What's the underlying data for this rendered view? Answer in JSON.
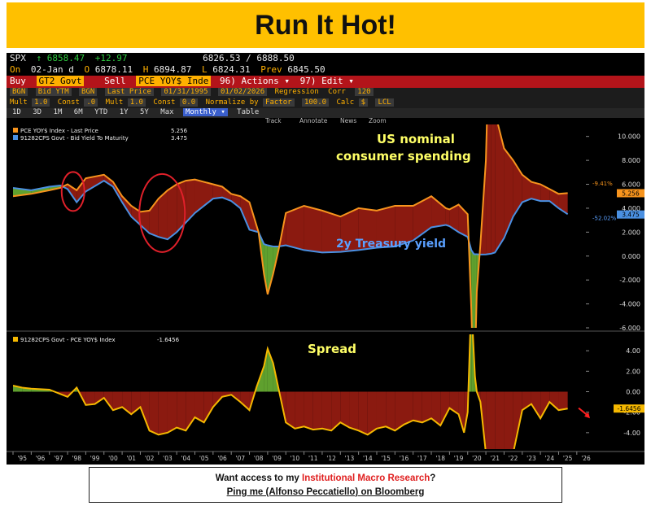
{
  "banner": {
    "title": "Run It Hot!"
  },
  "terminal": {
    "quote_line": {
      "ticker": "SPX",
      "arrow": "↑",
      "last": "6858.47",
      "change": "+12.97",
      "bid_ask": "6826.53 / 6888.50"
    },
    "ohlc_line": {
      "on": "On",
      "date": "02-Jan d",
      "open_label": "O",
      "open": "6878.11",
      "high_label": "H",
      "high": "6894.87",
      "low_label": "L",
      "low": "6824.31",
      "prev_label": "Prev",
      "prev": "6845.50"
    },
    "command_bar": {
      "buy": "Buy",
      "buy_field": "GT2 Govt",
      "sell": "Sell",
      "sell_field": "PCE YOY$ Inde",
      "actions": "96) Actions ▾",
      "edit": "97) Edit ▾"
    },
    "settings1": {
      "src1": "BGN",
      "field1": "Bid YTM",
      "src2": "BGN",
      "field2": "Last Price",
      "start": "01/31/1995",
      "end": "01/02/2026",
      "regression": "Regression",
      "corr": "Corr",
      "corr_val": "120"
    },
    "settings2": {
      "mult1": "Mult",
      "mult1_val": "1.0",
      "const1": "Const",
      "const1_val": ".0",
      "mult2": "Mult",
      "mult2_val": "1.0",
      "const2": "Const",
      "const2_val": "0.0",
      "normalize": "Normalize by",
      "normalize_val": "Factor",
      "norm_num": "100.0",
      "calc": "Calc",
      "calc_val": "$",
      "lcl": "LCL"
    },
    "period_tabs": [
      "1D",
      "3D",
      "1M",
      "6M",
      "YTD",
      "1Y",
      "5Y",
      "Max",
      "Monthly ▾",
      "Table"
    ],
    "chart_tools": [
      "Track",
      "Annotate",
      "News",
      "Zoom"
    ]
  },
  "chart_data": [
    {
      "type": "area",
      "legend": [
        {
          "name": "PCE YOY$ Index - Last Price",
          "value": "5.256",
          "color": "#f7941d"
        },
        {
          "name": "91282CPS Govt - Bid Yield To Maturity",
          "value": "3.475",
          "color": "#4a90e2"
        }
      ],
      "annotations": [
        "US nominal",
        "consumer spending",
        "2y Treasury yield"
      ],
      "right_labels": {
        "pce_change": "-9.41%",
        "yield_change": "-52.02%",
        "pce_last": "5.256",
        "yield_last": "3.475"
      },
      "ylim": [
        -6,
        11
      ],
      "ytick_labels": [
        "10.000",
        "8.000",
        "6.000",
        "4.000",
        "2.000",
        "0.000",
        "-2.000",
        "-4.000",
        "-6.000"
      ],
      "x": [
        1995.0,
        1996.0,
        1997.0,
        1997.6,
        1998.0,
        1998.5,
        1999.0,
        2000.0,
        2000.5,
        2001.0,
        2001.5,
        2002.0,
        2002.5,
        2003.0,
        2003.5,
        2004.0,
        2004.5,
        2005.0,
        2006.0,
        2006.5,
        2007.0,
        2007.5,
        2008.0,
        2008.5,
        2008.8,
        2009.0,
        2009.3,
        2009.6,
        2010.0,
        2011.0,
        2012.0,
        2013.0,
        2014.0,
        2015.0,
        2016.0,
        2017.0,
        2018.0,
        2018.8,
        2019.0,
        2019.5,
        2020.0,
        2020.2,
        2020.35,
        2020.5,
        2020.7,
        2021.0,
        2021.3,
        2021.5,
        2022.0,
        2022.5,
        2023.0,
        2023.5,
        2024.0,
        2024.5,
        2025.0,
        2025.5
      ],
      "pce": [
        5.0,
        5.2,
        5.5,
        5.7,
        6.0,
        5.5,
        6.5,
        6.8,
        6.2,
        5.0,
        4.2,
        3.7,
        3.8,
        4.8,
        5.5,
        6.0,
        6.3,
        6.4,
        6.0,
        5.8,
        5.2,
        5.0,
        4.5,
        2.0,
        -1.5,
        -3.2,
        -1.5,
        0.5,
        3.6,
        4.2,
        3.8,
        3.3,
        4.0,
        3.8,
        4.2,
        4.2,
        5.0,
        4.0,
        3.9,
        4.3,
        3.5,
        -4.5,
        -12.5,
        -3.0,
        1.0,
        8.0,
        25.0,
        12.0,
        9.0,
        8.0,
        6.8,
        6.2,
        6.0,
        5.6,
        5.2,
        5.26
      ],
      "yield": [
        5.7,
        5.5,
        5.8,
        5.9,
        5.6,
        4.5,
        5.4,
        6.3,
        5.8,
        4.5,
        3.3,
        2.6,
        1.9,
        1.6,
        1.4,
        2.0,
        2.8,
        3.6,
        4.8,
        4.9,
        4.6,
        4.0,
        2.2,
        2.0,
        1.0,
        0.9,
        0.8,
        0.8,
        0.9,
        0.5,
        0.3,
        0.35,
        0.5,
        0.7,
        0.8,
        1.3,
        2.4,
        2.6,
        2.5,
        2.0,
        1.6,
        0.5,
        0.15,
        0.15,
        0.13,
        0.14,
        0.2,
        0.3,
        1.5,
        3.3,
        4.5,
        4.8,
        4.6,
        4.6,
        4.0,
        3.5
      ]
    },
    {
      "type": "area",
      "title": "Spread",
      "legend": [
        {
          "name": "91282CPS Govt - PCE YOY$ Index",
          "value": "-1.6456",
          "color": "#f5b800"
        }
      ],
      "right_labels": {
        "last": "-1.6456"
      },
      "ylim": [
        -5.6,
        5.6
      ],
      "ytick_labels": [
        "4.00",
        "2.00",
        "0.00",
        "-2.00",
        "-4.00"
      ],
      "x": [
        1995.0,
        1995.5,
        1996.0,
        1997.0,
        1998.0,
        1998.5,
        1999.0,
        1999.5,
        2000.0,
        2000.5,
        2001.0,
        2001.5,
        2002.0,
        2002.5,
        2003.0,
        2003.5,
        2004.0,
        2004.5,
        2005.0,
        2005.5,
        2006.0,
        2006.5,
        2007.0,
        2007.5,
        2008.0,
        2008.4,
        2008.8,
        2009.0,
        2009.3,
        2009.6,
        2010.0,
        2010.5,
        2011.0,
        2011.5,
        2012.0,
        2012.5,
        2013.0,
        2013.5,
        2014.0,
        2014.5,
        2015.0,
        2015.5,
        2016.0,
        2016.5,
        2017.0,
        2017.5,
        2018.0,
        2018.5,
        2019.0,
        2019.5,
        2019.8,
        2020.0,
        2020.2,
        2020.3,
        2020.4,
        2020.5,
        2020.7,
        2021.0,
        2021.5,
        2022.0,
        2022.5,
        2023.0,
        2023.5,
        2024.0,
        2024.5,
        2025.0,
        2025.5
      ],
      "values": [
        0.6,
        0.4,
        0.3,
        0.2,
        -0.5,
        0.4,
        -1.3,
        -1.2,
        -0.6,
        -1.8,
        -1.5,
        -2.2,
        -1.5,
        -3.8,
        -4.2,
        -4.0,
        -3.5,
        -3.8,
        -2.5,
        -3.0,
        -1.5,
        -0.5,
        -0.3,
        -1.0,
        -1.8,
        0.5,
        2.5,
        4.2,
        2.8,
        0.3,
        -3.0,
        -3.6,
        -3.4,
        -3.7,
        -3.6,
        -3.8,
        -3.0,
        -3.5,
        -3.8,
        -4.2,
        -3.6,
        -3.4,
        -3.8,
        -3.2,
        -2.8,
        -3.0,
        -2.6,
        -3.3,
        -1.6,
        -2.2,
        -4.0,
        -2.0,
        9.0,
        5.0,
        1.5,
        0.0,
        -1.0,
        -6.0,
        -6.0,
        -5.8,
        -6.0,
        -1.8,
        -1.2,
        -2.6,
        -1.0,
        -1.8,
        -1.65
      ]
    }
  ],
  "x_axis": {
    "labels": [
      "'95",
      "'96",
      "'97",
      "'98",
      "'99",
      "'00",
      "'01",
      "'02",
      "'03",
      "'04",
      "'05",
      "'06",
      "'07",
      "'08",
      "'09",
      "'10",
      "'11",
      "'12",
      "'13",
      "'14",
      "'15",
      "'16",
      "'17",
      "'18",
      "'19",
      "'20",
      "'21",
      "'22",
      "'23",
      "'24",
      "'25",
      "'26"
    ]
  },
  "footer": {
    "line1_pre": "Want access to my ",
    "line1_red": "Institutional Macro Research",
    "line1_post": "?",
    "line2": "Ping me (Alfonso Peccatiello) on Bloomberg"
  },
  "colors": {
    "pos_fill": "#5fa02e",
    "neg_fill": "#8b1a10",
    "pce": "#f7941d",
    "yield": "#4a90e2",
    "spread": "#f5b800",
    "banner": "#ffc000"
  }
}
